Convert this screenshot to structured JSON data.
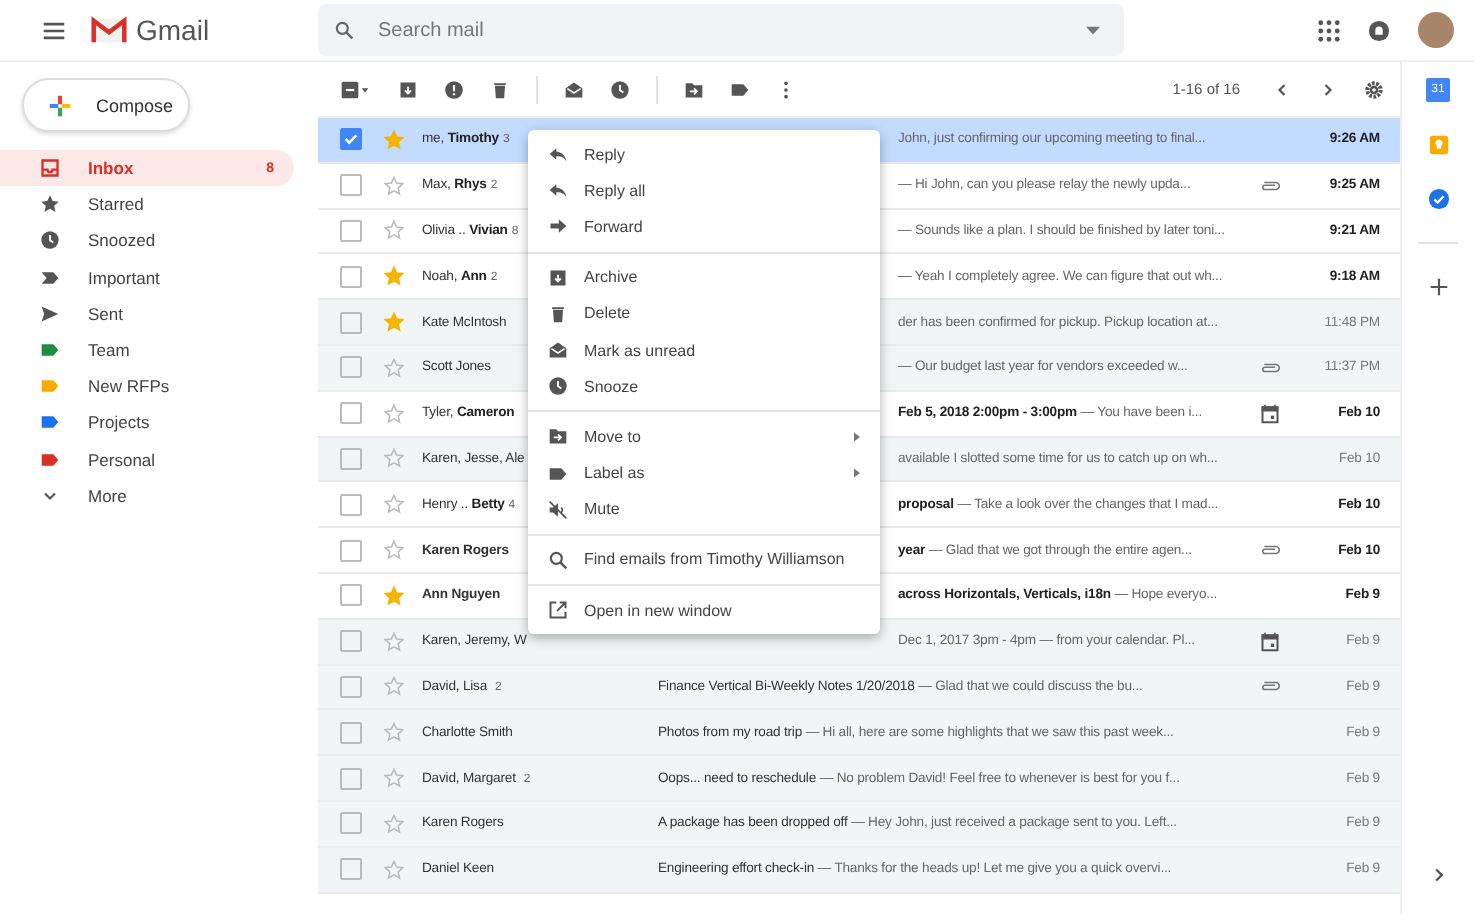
{
  "header": {
    "app_name": "Gmail",
    "search": {
      "placeholder": "Search mail"
    }
  },
  "compose": {
    "label": "Compose"
  },
  "sidebar": {
    "items": [
      {
        "kind": "inbox",
        "label": "Inbox",
        "count": "8",
        "selected": true
      },
      {
        "kind": "star",
        "label": "Starred",
        "selected": false
      },
      {
        "kind": "clock",
        "label": "Snoozed",
        "selected": false
      },
      {
        "kind": "important",
        "label": "Important",
        "selected": false
      },
      {
        "kind": "send",
        "label": "Sent",
        "selected": false
      },
      {
        "kind": "label",
        "label": "Team",
        "color": "#1e8e3e",
        "selected": false
      },
      {
        "kind": "label",
        "label": "New RFPs",
        "color": "#f9ab00",
        "selected": false
      },
      {
        "kind": "label",
        "label": "Projects",
        "color": "#1a73e8",
        "selected": false
      },
      {
        "kind": "label",
        "label": "Personal",
        "color": "#d93025",
        "selected": false
      },
      {
        "kind": "more",
        "label": "More",
        "selected": false
      }
    ]
  },
  "toolbar": {
    "page_info": "1-16 of 16"
  },
  "side_panel": {
    "calendar_day": "31"
  },
  "emails": [
    {
      "sender": "me, **Timothy**",
      "count": "3",
      "partly_hidden": true,
      "snippet": "John, just confirming our upcoming meeting to final...",
      "attachment": false,
      "event": false,
      "time": "9:26 AM",
      "unread": true,
      "selected": true,
      "checked": true,
      "starred": true
    },
    {
      "sender": "Max, **Rhys**",
      "count": "2",
      "partly_hidden": true,
      "snippet": "— Hi John, can you please relay the newly upda...",
      "attachment": true,
      "event": false,
      "time": "9:25 AM",
      "unread": true,
      "selected": false,
      "checked": false,
      "starred": false
    },
    {
      "sender": "Olivia .. **Vivian**",
      "count": "8",
      "partly_hidden": true,
      "snippet": "— Sounds like a plan. I should be finished by later toni...",
      "attachment": false,
      "event": false,
      "time": "9:21 AM",
      "unread": true,
      "selected": false,
      "checked": false,
      "starred": false
    },
    {
      "sender": "Noah, **Ann**",
      "count": "2",
      "partly_hidden": true,
      "snippet": "— Yeah I completely agree. We can figure that out wh...",
      "attachment": false,
      "event": false,
      "time": "9:18 AM",
      "unread": true,
      "selected": false,
      "checked": false,
      "starred": true
    },
    {
      "sender": "Kate McIntosh",
      "partly_hidden": true,
      "snippet": "der has been confirmed for pickup. Pickup location at...",
      "attachment": false,
      "event": false,
      "time": "11:48 PM",
      "unread": false,
      "selected": false,
      "checked": false,
      "starred": true
    },
    {
      "sender": "Scott Jones",
      "partly_hidden": true,
      "snippet": "— Our budget last year for vendors exceeded w...",
      "attachment": true,
      "event": false,
      "time": "11:37 PM",
      "unread": false,
      "selected": false,
      "checked": false,
      "starred": false
    },
    {
      "sender": "Tyler, **Cameron**",
      "partly_hidden": true,
      "subject": "Feb 5, 2018 2:00pm - 3:00pm",
      "snippet": "— You have been i...",
      "attachment": false,
      "event": true,
      "time": "Feb 10",
      "unread": true,
      "selected": false,
      "checked": false,
      "starred": false
    },
    {
      "sender": "Karen, Jesse, Ale",
      "partly_hidden": true,
      "snippet": "available I slotted some time for us to catch up on wh...",
      "attachment": false,
      "event": false,
      "time": "Feb 10",
      "unread": false,
      "selected": false,
      "checked": false,
      "starred": false
    },
    {
      "sender": "Henry .. **Betty**",
      "count": "4",
      "partly_hidden": true,
      "subject": "proposal",
      "snippet": "— Take a look over the changes that I mad...",
      "attachment": false,
      "event": false,
      "time": "Feb 10",
      "unread": true,
      "selected": false,
      "checked": false,
      "starred": false
    },
    {
      "sender": "Karen Rogers",
      "partly_hidden": true,
      "subject": "year",
      "snippet": "— Glad that we got through the entire agen...",
      "attachment": true,
      "event": false,
      "time": "Feb 10",
      "unread": true,
      "selected": false,
      "checked": false,
      "starred": false
    },
    {
      "sender": "Ann Nguyen",
      "partly_hidden": true,
      "subject": "across Horizontals, Verticals, i18n",
      "snippet": "— Hope everyo...",
      "attachment": false,
      "event": false,
      "time": "Feb 9",
      "unread": true,
      "selected": false,
      "checked": false,
      "starred": true
    },
    {
      "sender": "Karen, Jeremy, W",
      "partly_hidden": true,
      "snippet": "Dec 1, 2017 3pm - 4pm — from your calendar. Pl...",
      "attachment": false,
      "event": true,
      "time": "Feb 9",
      "unread": false,
      "selected": false,
      "checked": false,
      "starred": false
    },
    {
      "sender": "David, Lisa",
      "count": "2",
      "partly_hidden": false,
      "subject": "Finance Vertical Bi-Weekly Notes 1/20/2018",
      "snippet": "— Glad that we could discuss the bu...",
      "attachment": true,
      "event": false,
      "time": "Feb 9",
      "unread": false,
      "selected": false,
      "checked": false,
      "starred": false
    },
    {
      "sender": "Charlotte Smith",
      "partly_hidden": false,
      "subject": "Photos from my road trip",
      "snippet": "— Hi all, here are some highlights that we saw this past week...",
      "attachment": false,
      "event": false,
      "time": "Feb 9",
      "unread": false,
      "selected": false,
      "checked": false,
      "starred": false
    },
    {
      "sender": "David, Margaret",
      "count": "2",
      "partly_hidden": false,
      "subject": "Oops... need to reschedule",
      "snippet": "— No problem David! Feel free to whenever is best for you f...",
      "attachment": false,
      "event": false,
      "time": "Feb 9",
      "unread": false,
      "selected": false,
      "checked": false,
      "starred": false
    },
    {
      "sender": "Karen Rogers",
      "partly_hidden": false,
      "subject": "A package has been dropped off",
      "snippet": "— Hey John, just received a package sent to you. Left...",
      "attachment": false,
      "event": false,
      "time": "Feb 9",
      "unread": false,
      "selected": false,
      "checked": false,
      "starred": false
    },
    {
      "sender": "Daniel Keen",
      "partly_hidden": false,
      "subject": "Engineering effort check-in",
      "snippet": "— Thanks for the heads up! Let me give you a quick overvi...",
      "attachment": false,
      "event": false,
      "time": "Feb 9",
      "unread": false,
      "selected": false,
      "checked": false,
      "starred": false
    }
  ],
  "context_menu": {
    "sections": [
      [
        {
          "kind": "reply",
          "label": "Reply",
          "has_submenu": false
        },
        {
          "kind": "reply",
          "label": "Reply all",
          "has_submenu": false
        },
        {
          "kind": "forward",
          "label": "Forward",
          "has_submenu": false
        }
      ],
      [
        {
          "kind": "archive",
          "label": "Archive",
          "has_submenu": false
        },
        {
          "kind": "trash",
          "label": "Delete",
          "has_submenu": false
        },
        {
          "kind": "envelope",
          "label": "Mark as unread",
          "has_submenu": false
        },
        {
          "kind": "clock",
          "label": "Snooze",
          "has_submenu": false
        }
      ],
      [
        {
          "kind": "folder",
          "label": "Move to",
          "has_submenu": true
        },
        {
          "kind": "label",
          "label": "Label as",
          "has_submenu": true
        },
        {
          "kind": "mute",
          "label": "Mute",
          "has_submenu": false
        }
      ],
      [
        {
          "kind": "search",
          "label": "Find emails from Timothy Williamson",
          "has_submenu": false
        }
      ],
      [
        {
          "kind": "external",
          "label": "Open in new window",
          "has_submenu": false
        }
      ]
    ]
  }
}
